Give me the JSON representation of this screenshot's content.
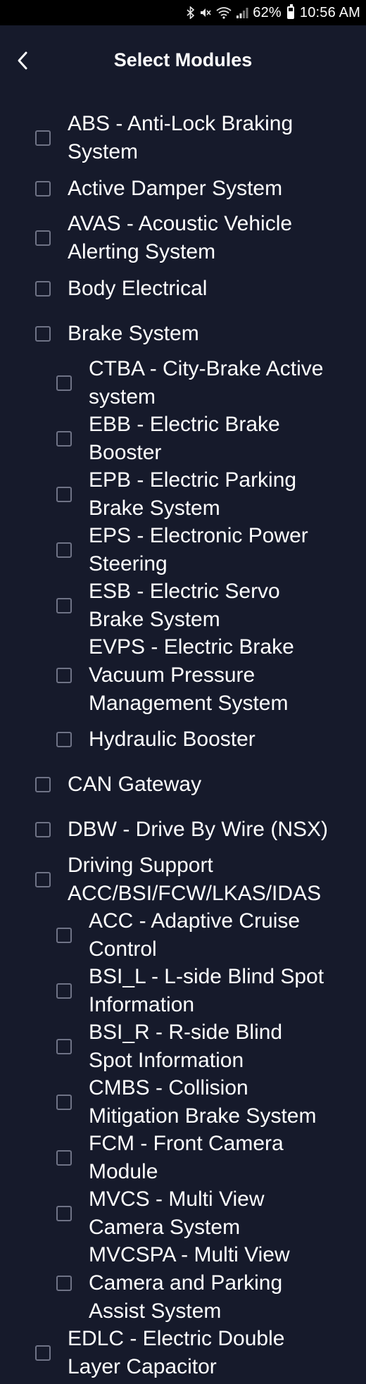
{
  "status_bar": {
    "icons": [
      "bluetooth-icon",
      "mute-icon",
      "wifi-icon",
      "signal-icon"
    ],
    "battery_percent": "62%",
    "battery_level": 0.62,
    "time": "10:56 AM"
  },
  "header": {
    "title": "Select Modules",
    "back_icon": "chevron-left-icon"
  },
  "modules": [
    {
      "label": "ABS - Anti-Lock Braking\nSystem",
      "checked": false,
      "level": 0
    },
    {
      "label": "Active Damper System",
      "checked": false,
      "level": 0
    },
    {
      "label": "AVAS - Acoustic Vehicle\nAlerting System",
      "checked": false,
      "level": 0
    },
    {
      "label": "Body Electrical",
      "checked": false,
      "level": 0
    },
    {
      "label": "Brake System",
      "checked": false,
      "level": 0
    },
    {
      "label": "CTBA - City-Brake Active\nsystem",
      "checked": false,
      "level": 1
    },
    {
      "label": "EBB - Electric Brake\nBooster",
      "checked": false,
      "level": 1
    },
    {
      "label": "EPB - Electric Parking\nBrake System",
      "checked": false,
      "level": 1
    },
    {
      "label": "EPS - Electronic Power\nSteering",
      "checked": false,
      "level": 1
    },
    {
      "label": "ESB - Electric Servo\nBrake System",
      "checked": false,
      "level": 1
    },
    {
      "label": "EVPS - Electric Brake\nVacuum Pressure\nManagement System",
      "checked": false,
      "level": 1
    },
    {
      "label": "Hydraulic Booster",
      "checked": false,
      "level": 1
    },
    {
      "label": "CAN Gateway",
      "checked": false,
      "level": 0
    },
    {
      "label": "DBW - Drive By Wire (NSX)",
      "checked": false,
      "level": 0
    },
    {
      "label": "Driving Support\nACC/BSI/FCW/LKAS/IDAS",
      "checked": false,
      "level": 0
    },
    {
      "label": "ACC - Adaptive Cruise\nControl",
      "checked": false,
      "level": 1
    },
    {
      "label": "BSI_L - L-side Blind Spot\nInformation",
      "checked": false,
      "level": 1
    },
    {
      "label": "BSI_R - R-side Blind\nSpot Information",
      "checked": false,
      "level": 1
    },
    {
      "label": "CMBS - Collision\nMitigation Brake System",
      "checked": false,
      "level": 1
    },
    {
      "label": "FCM - Front Camera\nModule",
      "checked": false,
      "level": 1
    },
    {
      "label": "MVCS - Multi View\nCamera System",
      "checked": false,
      "level": 1
    },
    {
      "label": "MVCSPA - Multi View\nCamera and Parking\nAssist System",
      "checked": false,
      "level": 1
    },
    {
      "label": "EDLC - Electric Double\nLayer Capacitor",
      "checked": false,
      "level": 0
    }
  ]
}
